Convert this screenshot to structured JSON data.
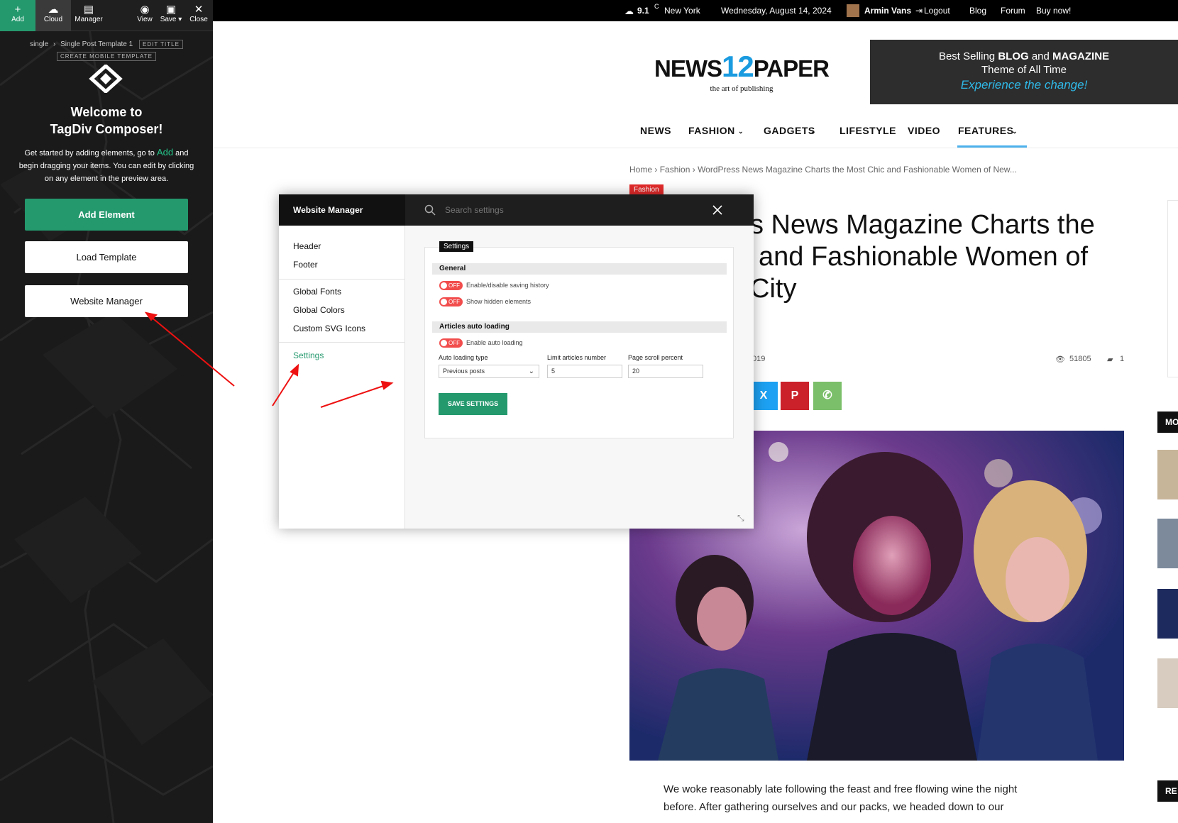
{
  "composer": {
    "toolbar": [
      {
        "label": "Add",
        "icon": "+"
      },
      {
        "label": "Cloud",
        "icon": "☁"
      },
      {
        "label": "Manager",
        "icon": "▤"
      },
      {
        "label": "View",
        "icon": "◉"
      },
      {
        "label": "Save ▾",
        "icon": "▣"
      },
      {
        "label": "Close",
        "icon": "✕"
      }
    ],
    "breadcrumb_root": "single",
    "breadcrumb_sep": "›",
    "breadcrumb_template": "Single Post Template 1",
    "edit_title": "EDIT TITLE",
    "create_mobile": "CREATE MOBILE TEMPLATE",
    "welcome_line1": "Welcome to",
    "welcome_line2": "TagDiv Composer!",
    "intro_a": "Get started by adding elements, go to",
    "intro_link": "Add",
    "intro_b": "and begin dragging your items. You can edit by clicking on any element in the preview area.",
    "add_element": "Add Element",
    "load_template": "Load Template",
    "website_manager": "Website Manager"
  },
  "topbar": {
    "temperature": "9.1",
    "unit": "C",
    "city": "New York",
    "date": "Wednesday, August 14, 2024",
    "user": "Armin Vans",
    "logout": "Logout",
    "links": [
      "Blog",
      "Forum",
      "Buy now!"
    ]
  },
  "header": {
    "logo_left": "NEWS",
    "logo_num": "12",
    "logo_right": "PAPER",
    "tagline": "the art of publishing",
    "ad_line1a": "Best Selling ",
    "ad_line1b": "BLOG",
    "ad_line1c": " and ",
    "ad_line1d": "MAGAZINE",
    "ad_line2": "Theme of All Time",
    "ad_line3": "Experience the change!"
  },
  "nav": [
    "NEWS",
    "FASHION",
    "GADGETS",
    "LIFESTYLE",
    "VIDEO",
    "FEATURES"
  ],
  "article": {
    "crumb_home": "Home",
    "crumb_cat": "Fashion",
    "crumb_title": "WordPress News Magazine Charts the Most Chic and Fashionable Women of New...",
    "category": "Fashion",
    "title_l1": "s News Magazine Charts the",
    "title_l2": "and Fashionable Women of",
    "title_l3": "City",
    "date_fragment": "019",
    "views": "51805",
    "comments": "1",
    "body_l1": "We woke reasonably late following the feast and free flowing wine the night",
    "body_l2": "before. After gathering ourselves and our packs, we headed down to our"
  },
  "sidebar": {
    "block1": "MO",
    "block2": "RE"
  },
  "modal": {
    "title": "Website Manager",
    "search_placeholder": "Search settings",
    "menu": [
      "Header",
      "Footer",
      "Global Fonts",
      "Global Colors",
      "Custom SVG Icons",
      "Settings"
    ],
    "settings_tab": "Settings",
    "general": "General",
    "toggle_off": "OFF",
    "opt_history": "Enable/disable saving history",
    "opt_hidden": "Show hidden elements",
    "autoload": "Articles auto loading",
    "opt_autoload": "Enable auto loading",
    "f_type_label": "Auto loading type",
    "f_type_value": "Previous posts",
    "f_limit_label": "Limit articles number",
    "f_limit_value": "5",
    "f_scroll_label": "Page scroll percent",
    "f_scroll_value": "20",
    "save": "SAVE SETTINGS"
  },
  "colors": {
    "accent": "#24996e",
    "toggle_off": "#f24d4d",
    "nav_underline": "#4db2ec"
  }
}
